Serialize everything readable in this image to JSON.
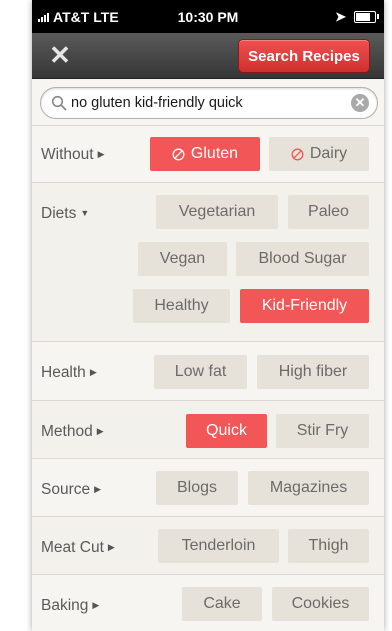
{
  "status_bar": {
    "carrier": "AT&T",
    "network": "LTE",
    "time": "10:30 PM"
  },
  "nav": {
    "close_glyph": "✕",
    "search_button": "Search Recipes"
  },
  "search": {
    "query": "no gluten kid-friendly quick",
    "placeholder": ""
  },
  "colors": {
    "accent": "#f25656",
    "chip": "#e6e2d9",
    "chip_text": "#6b6b6b"
  },
  "filters": {
    "without": {
      "label": "Without",
      "options": [
        {
          "label": "Gluten",
          "selected": true
        },
        {
          "label": "Dairy",
          "selected": false
        }
      ]
    },
    "diets": {
      "label": "Diets",
      "options": [
        {
          "label": "Vegetarian",
          "selected": false
        },
        {
          "label": "Paleo",
          "selected": false
        },
        {
          "label": "Vegan",
          "selected": false
        },
        {
          "label": "Blood Sugar",
          "selected": false
        },
        {
          "label": "Healthy",
          "selected": false
        },
        {
          "label": "Kid-Friendly",
          "selected": true
        }
      ]
    },
    "health": {
      "label": "Health",
      "options": [
        {
          "label": "Low fat",
          "selected": false
        },
        {
          "label": "High fiber",
          "selected": false
        }
      ]
    },
    "method": {
      "label": "Method",
      "options": [
        {
          "label": "Quick",
          "selected": true
        },
        {
          "label": "Stir Fry",
          "selected": false
        }
      ]
    },
    "source": {
      "label": "Source",
      "options": [
        {
          "label": "Blogs",
          "selected": false
        },
        {
          "label": "Magazines",
          "selected": false
        }
      ]
    },
    "meat_cut": {
      "label": "Meat Cut",
      "options": [
        {
          "label": "Tenderloin",
          "selected": false
        },
        {
          "label": "Thigh",
          "selected": false
        }
      ]
    },
    "baking": {
      "label": "Baking",
      "options": [
        {
          "label": "Cake",
          "selected": false
        },
        {
          "label": "Cookies",
          "selected": false
        }
      ]
    }
  }
}
